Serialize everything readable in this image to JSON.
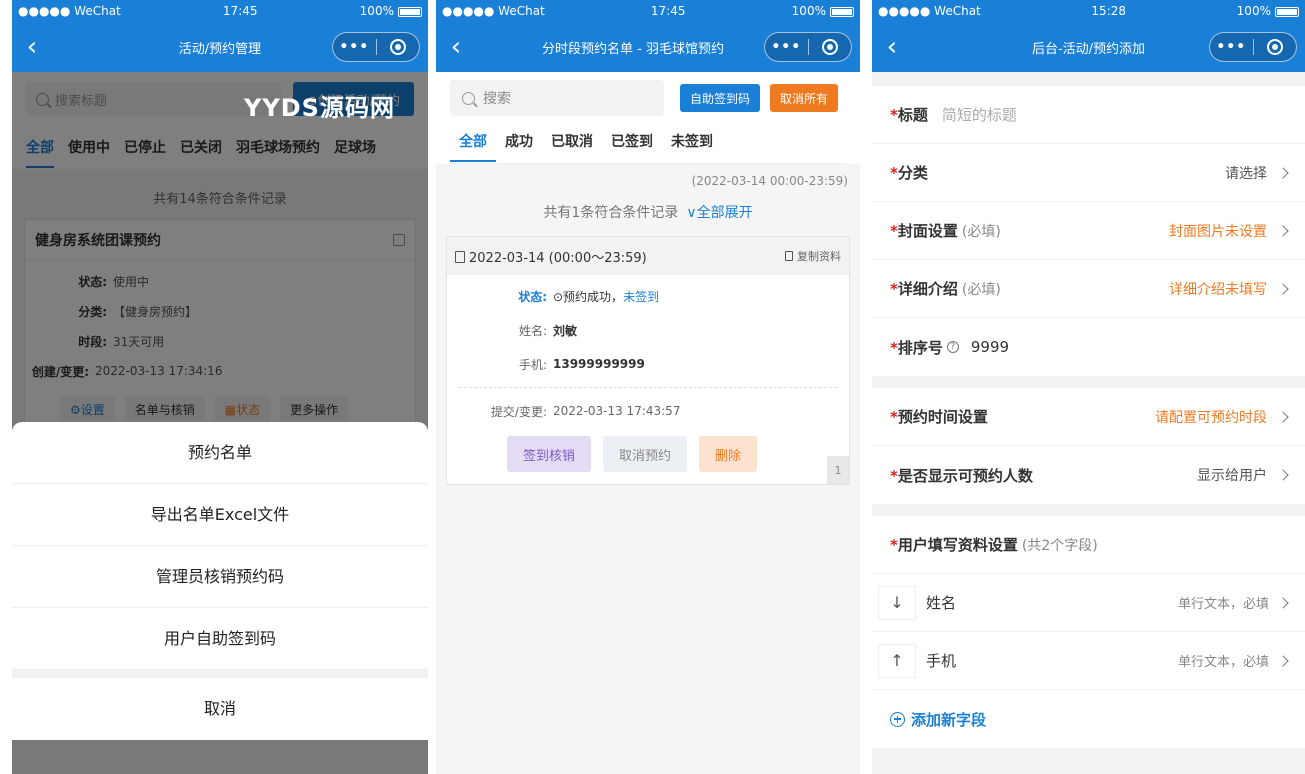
{
  "status": {
    "carrier": "●●●●● WeChat",
    "battery": "100%",
    "time1": "17:45",
    "time2": "17:45",
    "time3": "15:28"
  },
  "capsule": {
    "more": "•••"
  },
  "watermark": "YYDS源码网",
  "p1": {
    "title": "活动/预约管理",
    "search_placeholder": "搜索标题",
    "create_button": "⊕创建活动/预约",
    "tabs": [
      "全部",
      "使用中",
      "已停止",
      "已关闭",
      "羽毛球场预约",
      "足球场"
    ],
    "count_text": "共有14条符合条件记录",
    "card": {
      "title": "健身房系统团课预约",
      "rows": [
        {
          "k": "状态:",
          "v": "使用中"
        },
        {
          "k": "分类:",
          "v": "【健身房预约】"
        },
        {
          "k": "时段:",
          "v": "31天可用"
        },
        {
          "k": "创建/变更:",
          "v": "2022-03-13 17:34:16"
        }
      ],
      "actions": [
        "⚙设置",
        "名单与核销",
        "▦状态",
        "更多操作"
      ]
    },
    "sheet": {
      "items": [
        "预约名单",
        "导出名单Excel文件",
        "管理员核销预约码",
        "用户自助签到码"
      ],
      "cancel": "取消"
    }
  },
  "p2": {
    "title": "分时段预约名单 - 羽毛球馆预约",
    "search_placeholder": "搜索",
    "btn_checkin": "自助签到码",
    "btn_cancel_all": "取消所有",
    "tabs": [
      "全部",
      "成功",
      "已取消",
      "已签到",
      "未签到"
    ],
    "date_range": "(2022-03-14 00:00-23:59)",
    "count_text": "共有1条符合条件记录",
    "expand_all": "∨全部展开",
    "card": {
      "date": "2022-03-14 (00:00～23:59)",
      "copy": "复制资料",
      "status_label": "状态:",
      "status_value": "⊙预约成功，",
      "status_extra": "未签到",
      "name_label": "姓名:",
      "name_value": "刘敏",
      "phone_label": "手机:",
      "phone_value": "13999999999",
      "submit_label": "提交/变更:",
      "submit_value": "2022-03-13 17:43:57",
      "btn_checkin": "签到核销",
      "btn_cancel": "取消预约",
      "btn_delete": "删除",
      "page": "1"
    }
  },
  "p3": {
    "title": "后台-活动/预约添加",
    "title_field": {
      "label": "标题",
      "placeholder": "简短的标题"
    },
    "category": {
      "label": "分类",
      "value": "请选择"
    },
    "cover": {
      "label": "封面设置",
      "hint": "(必填)",
      "value": "封面图片未设置"
    },
    "detail": {
      "label": "详细介绍",
      "hint": "(必填)",
      "value": "详细介绍未填写"
    },
    "order": {
      "label": "排序号",
      "value": "9999"
    },
    "time_setting": {
      "label": "预约时间设置",
      "value": "请配置可预约时段"
    },
    "show_count": {
      "label": "是否显示可预约人数",
      "value": "显示给用户"
    },
    "user_fields": {
      "label": "用户填写资料设置",
      "hint": "(共2个字段)"
    },
    "fields": [
      {
        "arrow": "↓",
        "name": "姓名",
        "type": "单行文本，必填"
      },
      {
        "arrow": "↑",
        "name": "手机",
        "type": "单行文本，必填"
      }
    ],
    "add_field": "添加新字段",
    "star": "*"
  }
}
